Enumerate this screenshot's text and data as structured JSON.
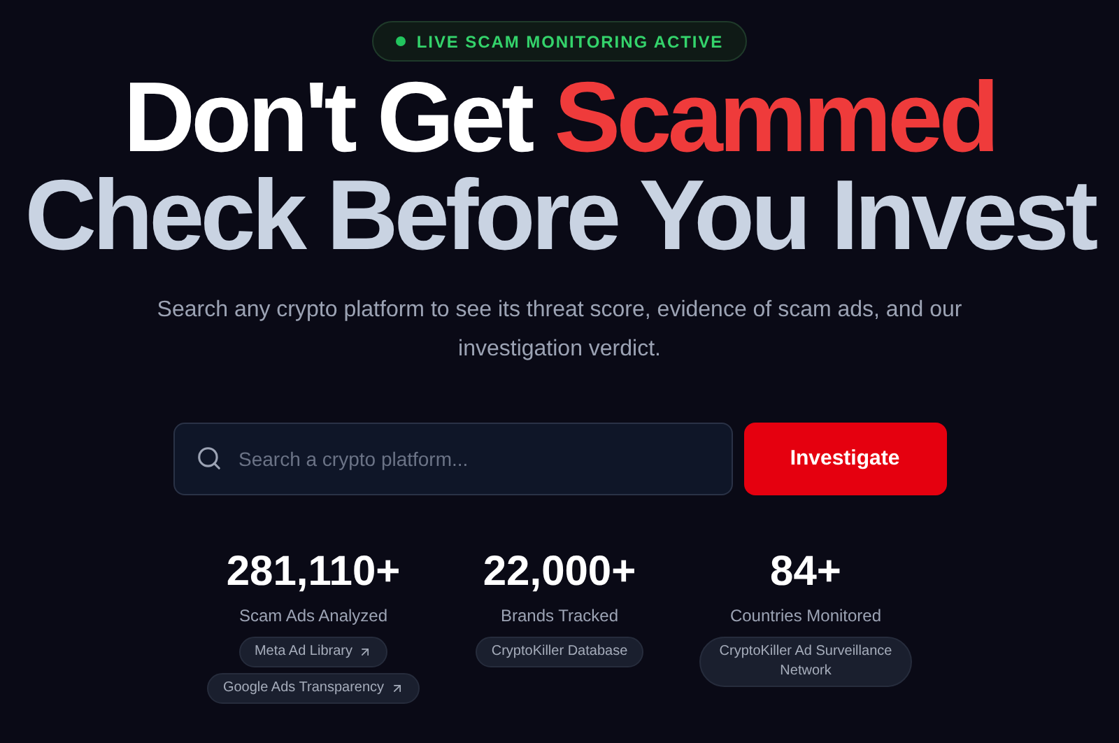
{
  "status_badge": {
    "label": "LIVE SCAM MONITORING ACTIVE",
    "live": true
  },
  "headline": {
    "line1": "Don't Get",
    "highlight": "Scammed",
    "line2": "Check Before You Invest"
  },
  "subtitle": "Search any crypto platform to see its threat score, evidence of scam ads, and our investigation verdict.",
  "search": {
    "placeholder": "Search a crypto platform...",
    "button": "Investigate"
  },
  "stats": [
    {
      "value": "281,110+",
      "label": "Scam Ads Analyzed",
      "sources": [
        {
          "label": "Meta Ad Library",
          "external": true
        },
        {
          "label": "Google Ads Transparency",
          "external": true
        }
      ]
    },
    {
      "value": "22,000+",
      "label": "Brands Tracked",
      "sources": [
        {
          "label": "CryptoKiller Database",
          "external": false
        }
      ]
    },
    {
      "value": "84+",
      "label": "Countries Monitored",
      "sources": [
        {
          "label": "CryptoKiller Ad Surveillance Network",
          "external": false
        }
      ]
    }
  ]
}
